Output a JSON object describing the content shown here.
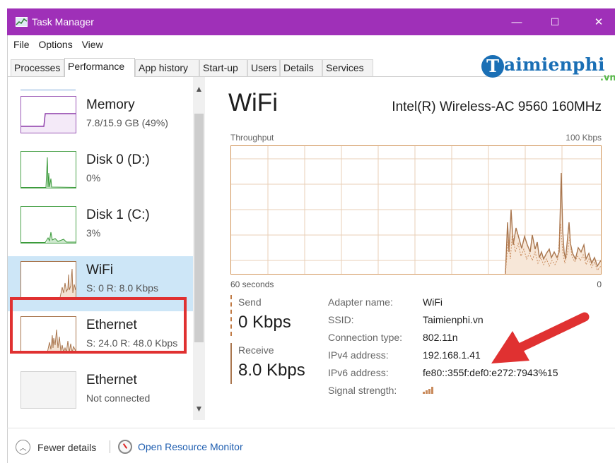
{
  "window": {
    "title": "Task Manager",
    "minimize": "—",
    "maximize": "☐",
    "close": "✕"
  },
  "menu": [
    "File",
    "Options",
    "View"
  ],
  "tabs": [
    "Processes",
    "Performance",
    "App history",
    "Start-up",
    "Users",
    "Details",
    "Services"
  ],
  "active_tab": "Performance",
  "watermark": {
    "mark": "T",
    "text": "aimienphi",
    "suffix": ".vn"
  },
  "sidebar": {
    "items": [
      {
        "name": "Memory",
        "sub": "7.8/15.9 GB (49%)"
      },
      {
        "name": "Disk 0 (D:)",
        "sub": "0%"
      },
      {
        "name": "Disk 1 (C:)",
        "sub": "3%"
      },
      {
        "name": "WiFi",
        "sub": "S: 0 R: 8.0 Kbps"
      },
      {
        "name": "Ethernet",
        "sub": "S: 24.0 R: 48.0 Kbps"
      },
      {
        "name": "Ethernet",
        "sub": "Not connected"
      }
    ],
    "selected": "WiFi",
    "scroll_up": "▲",
    "scroll_down": "▼"
  },
  "main": {
    "heading": "WiFi",
    "adapter_model": "Intel(R) Wireless-AC 9560 160MHz",
    "graph_label": "Throughput",
    "graph_max": "100 Kbps",
    "axis_left": "60 seconds",
    "axis_right": "0",
    "send_label": "Send",
    "send_value": "0 Kbps",
    "receive_label": "Receive",
    "receive_value": "8.0 Kbps",
    "properties": [
      {
        "key": "Adapter name:",
        "value": "WiFi"
      },
      {
        "key": "SSID:",
        "value": "Taimienphi.vn"
      },
      {
        "key": "Connection type:",
        "value": "802.11n"
      },
      {
        "key": "IPv4 address:",
        "value": "192.168.1.41"
      },
      {
        "key": "IPv6 address:",
        "value": "fe80::355f:def0:e272:7943%15"
      },
      {
        "key": "Signal strength:",
        "value": ""
      }
    ]
  },
  "footer": {
    "fewer_details": "Fewer details",
    "resource_monitor": "Open Resource Monitor"
  },
  "colors": {
    "titlebar": "#9f30b8",
    "network": "#a9764e",
    "memory": "#8b3aa8",
    "disk": "#4aa24a",
    "highlight": "#e03131",
    "link": "#1f5eb0"
  }
}
